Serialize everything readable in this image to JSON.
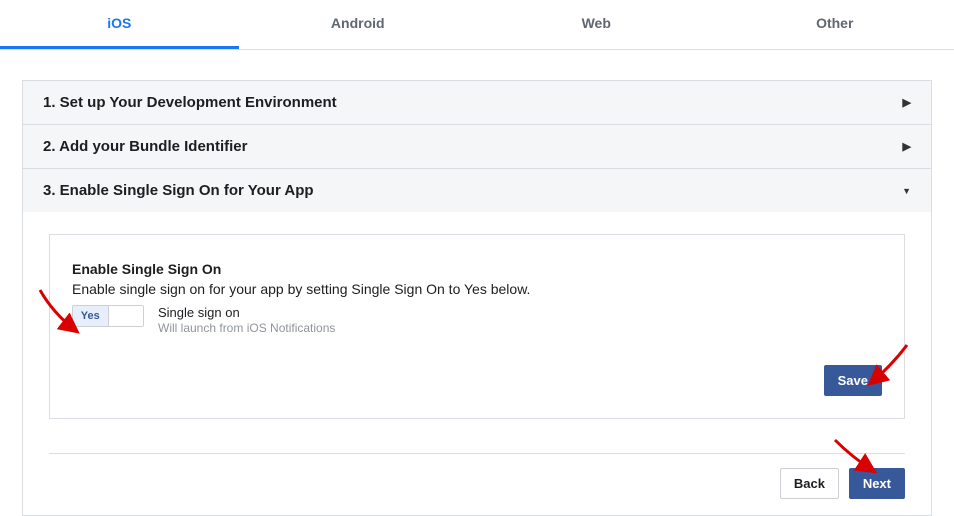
{
  "tabs": {
    "ios": "iOS",
    "android": "Android",
    "web": "Web",
    "other": "Other"
  },
  "accordion": {
    "item1": "1. Set up Your Development Environment",
    "item2": "2. Add your Bundle Identifier",
    "item3": "3. Enable Single Sign On for Your App"
  },
  "panel": {
    "heading": "Enable Single Sign On",
    "sub": "Enable single sign on for your app by setting Single Sign On to Yes below.",
    "toggle_yes": "Yes",
    "toggle_label": "Single sign on",
    "toggle_caption": "Will launch from iOS Notifications",
    "save": "Save"
  },
  "footer": {
    "back": "Back",
    "next": "Next"
  }
}
